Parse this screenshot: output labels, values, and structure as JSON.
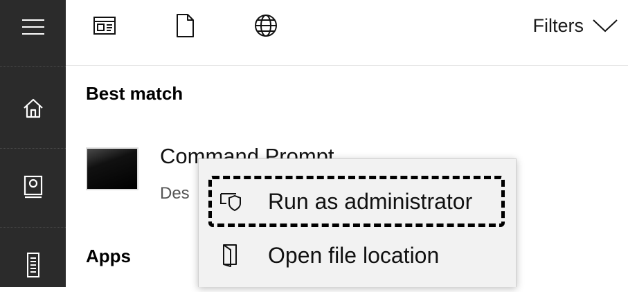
{
  "sidebar": {
    "items": [
      {
        "name": "menu",
        "icon": "hamburger-menu-icon"
      },
      {
        "name": "home",
        "icon": "home-icon"
      },
      {
        "name": "documents",
        "icon": "notebook-icon"
      },
      {
        "name": "device",
        "icon": "tower-icon"
      }
    ]
  },
  "toolbar": {
    "icons": [
      "apps-filter-icon",
      "documents-filter-icon",
      "web-filter-icon"
    ],
    "filters_label": "Filters"
  },
  "results": {
    "best_match_heading": "Best match",
    "best_match": {
      "name": "Command Prompt",
      "subtitle": "Des",
      "icon": "command-prompt-icon"
    },
    "apps_heading": "Apps"
  },
  "context_menu": {
    "items": [
      {
        "label": "Run as administrator",
        "icon": "admin-shield-icon",
        "highlighted": true
      },
      {
        "label": "Open file location",
        "icon": "file-location-icon",
        "highlighted": false
      }
    ]
  },
  "colors": {
    "sidebar_bg": "#2b2b2b",
    "menu_bg": "#f2f2f2",
    "highlight_border": "#000000"
  }
}
